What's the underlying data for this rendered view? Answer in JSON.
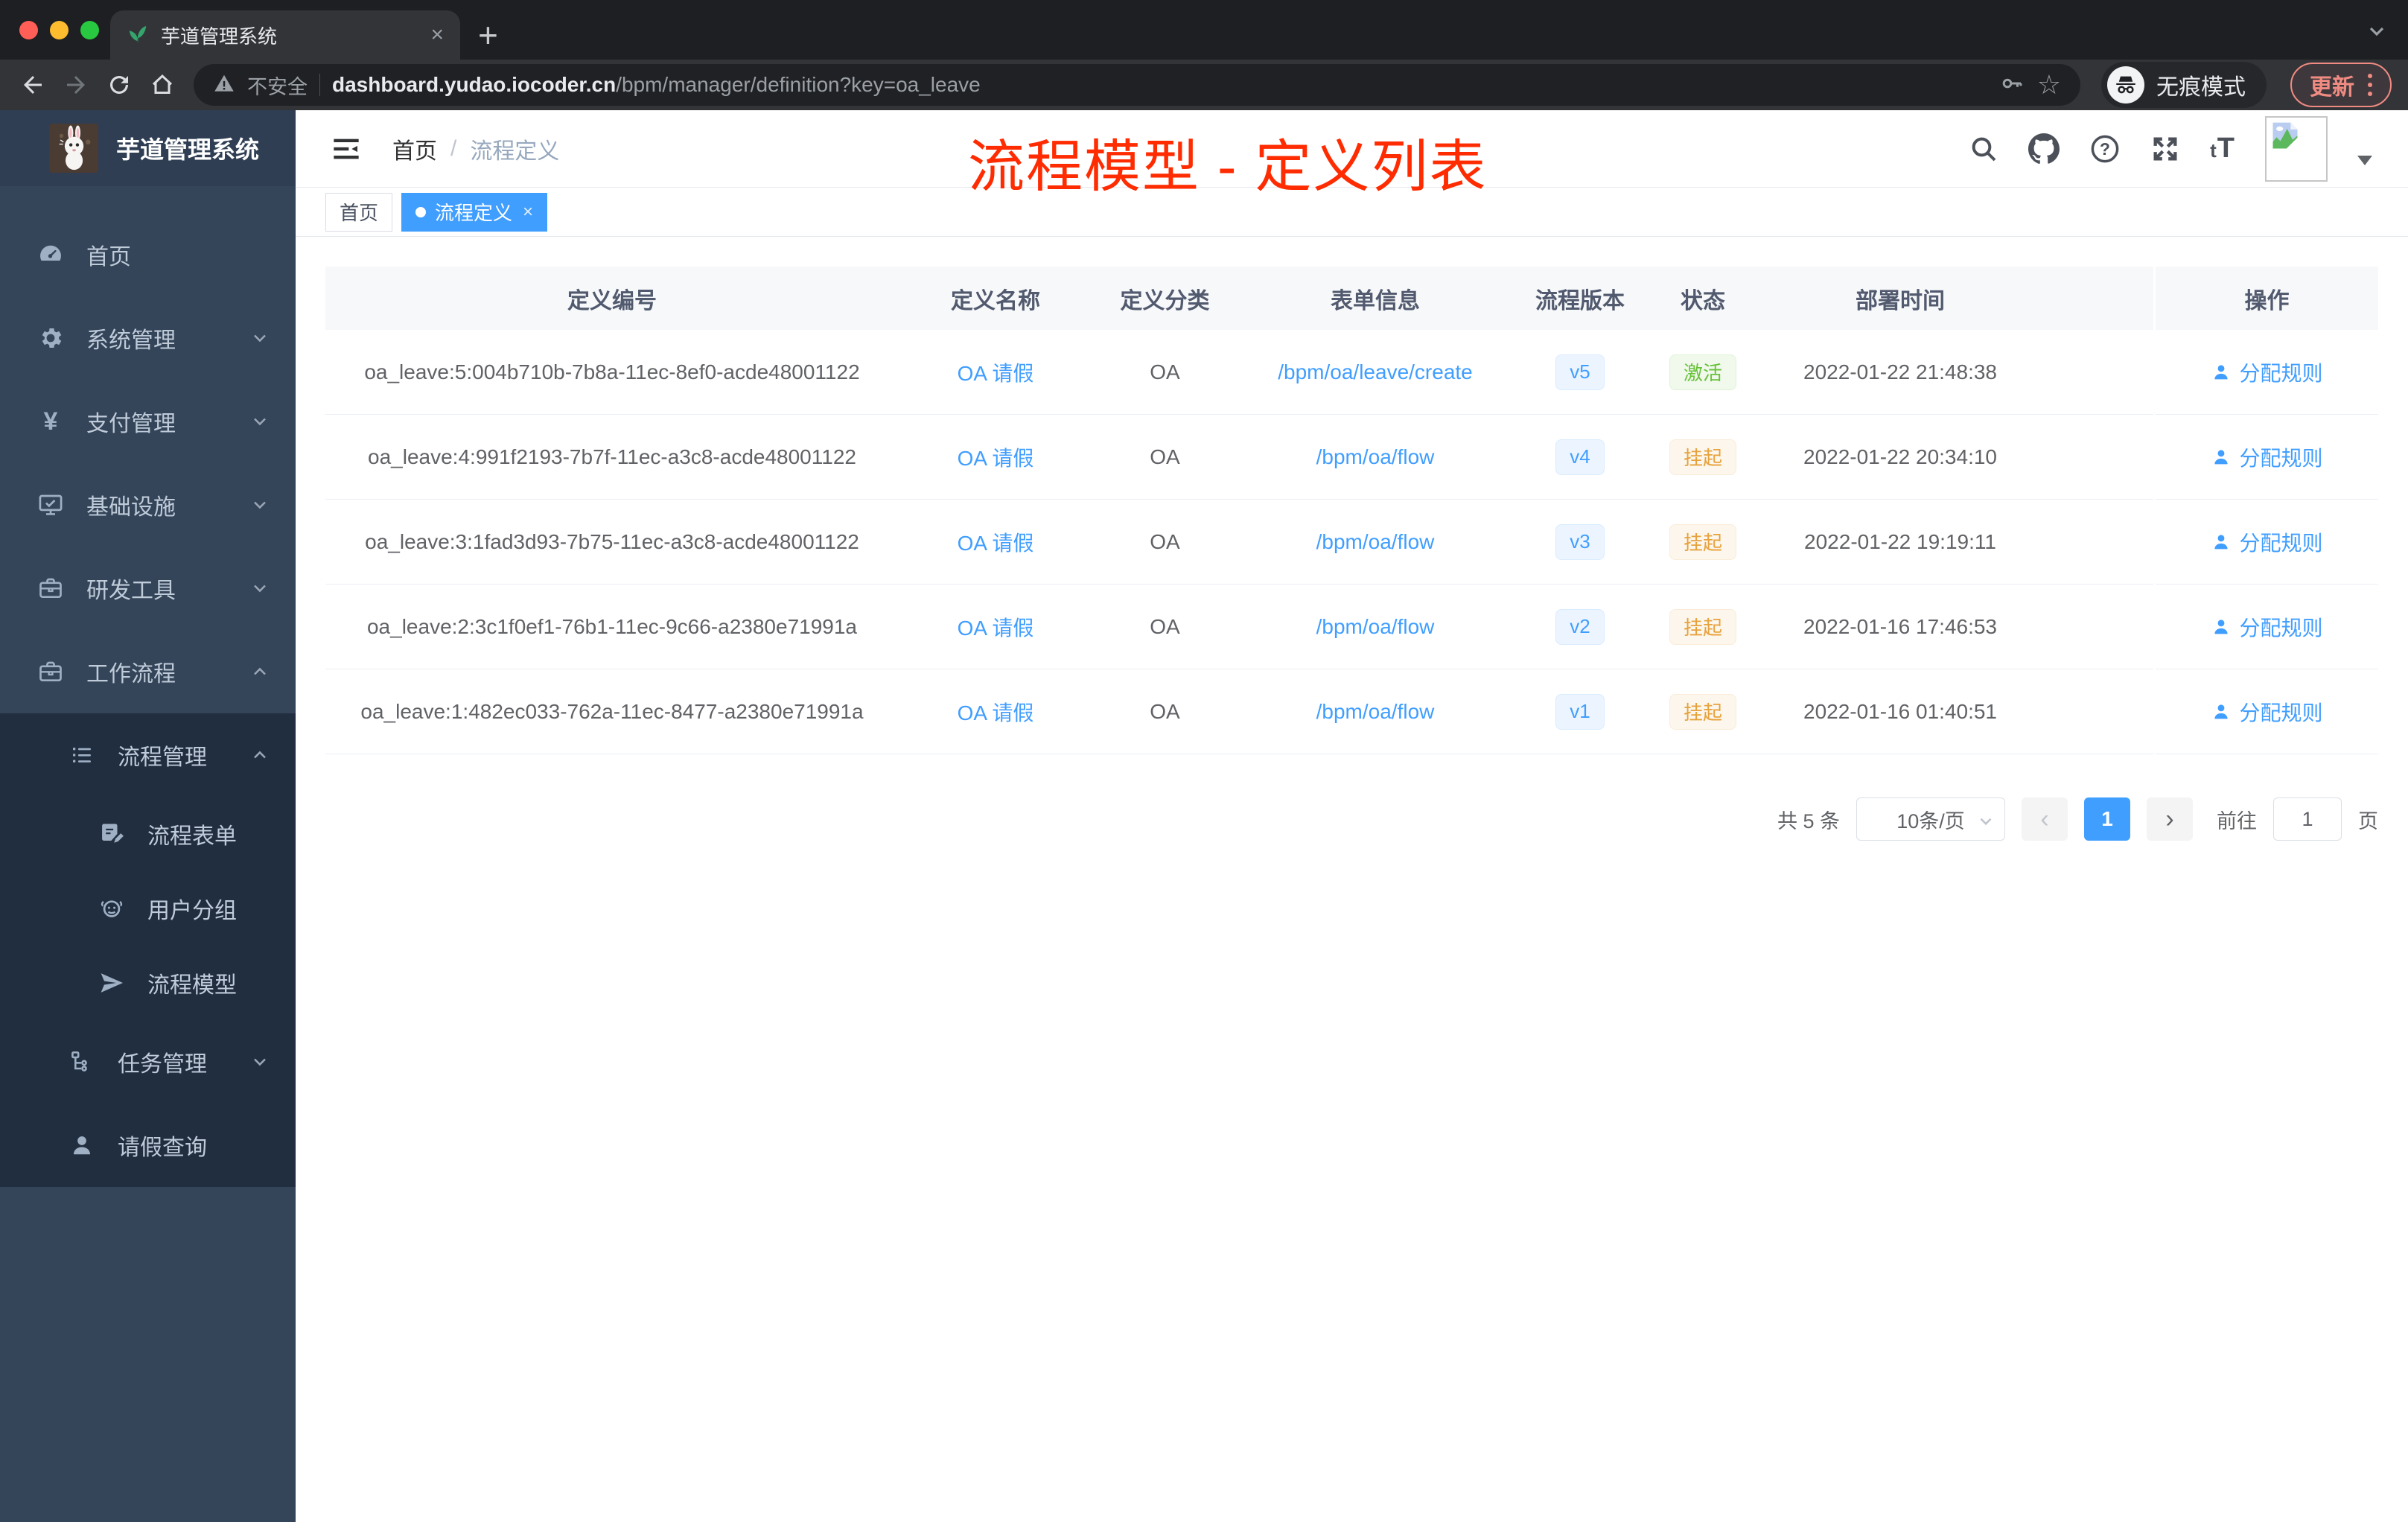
{
  "browser": {
    "tab_title": "芋道管理系统",
    "new_tab": "+",
    "security_label": "不安全",
    "url_host": "dashboard.yudao.iocoder.cn",
    "url_path": "/bpm/manager/definition?key=oa_leave",
    "incognito_label": "无痕模式",
    "update_label": "更新"
  },
  "sidebar": {
    "logo_title": "芋道管理系统",
    "items": [
      {
        "label": "首页",
        "icon": "dashboard",
        "level": 0,
        "chevron": "",
        "sub": false
      },
      {
        "label": "系统管理",
        "icon": "gear",
        "level": 0,
        "chevron": "down",
        "sub": false
      },
      {
        "label": "支付管理",
        "icon": "yen",
        "level": 0,
        "chevron": "down",
        "sub": false
      },
      {
        "label": "基础设施",
        "icon": "monitor",
        "level": 0,
        "chevron": "down",
        "sub": false
      },
      {
        "label": "研发工具",
        "icon": "toolbox",
        "level": 0,
        "chevron": "down",
        "sub": false
      },
      {
        "label": "工作流程",
        "icon": "briefcase",
        "level": 0,
        "chevron": "up",
        "sub": false
      },
      {
        "label": "流程管理",
        "icon": "list",
        "level": 1,
        "chevron": "up",
        "sub": true
      },
      {
        "label": "流程表单",
        "icon": "form",
        "level": 2,
        "chevron": "",
        "sub": true
      },
      {
        "label": "用户分组",
        "icon": "users",
        "level": 2,
        "chevron": "",
        "sub": true
      },
      {
        "label": "流程模型",
        "icon": "send",
        "level": 2,
        "chevron": "",
        "sub": true
      },
      {
        "label": "任务管理",
        "icon": "tree",
        "level": 1,
        "chevron": "down",
        "sub": true
      },
      {
        "label": "请假查询",
        "icon": "user",
        "level": 1,
        "chevron": "",
        "sub": true
      }
    ]
  },
  "navbar": {
    "breadcrumb_home": "首页",
    "breadcrumb_sep": "/",
    "breadcrumb_current": "流程定义",
    "annotation": "流程模型 - 定义列表"
  },
  "tags": [
    {
      "label": "首页",
      "active": false
    },
    {
      "label": "流程定义",
      "active": true,
      "close": "×"
    }
  ],
  "table": {
    "columns": [
      "定义编号",
      "定义名称",
      "定义分类",
      "表单信息",
      "流程版本",
      "状态",
      "部署时间",
      "操作"
    ],
    "action_label": "分配规则",
    "rows": [
      {
        "id": "oa_leave:5:004b710b-7b8a-11ec-8ef0-acde48001122",
        "name": "OA 请假",
        "category": "OA",
        "form": "/bpm/oa/leave/create",
        "version": "v5",
        "status": "active",
        "status_label": "激活",
        "deploy_time": "2022-01-22 21:48:38"
      },
      {
        "id": "oa_leave:4:991f2193-7b7f-11ec-a3c8-acde48001122",
        "name": "OA 请假",
        "category": "OA",
        "form": "/bpm/oa/flow",
        "version": "v4",
        "status": "suspended",
        "status_label": "挂起",
        "deploy_time": "2022-01-22 20:34:10"
      },
      {
        "id": "oa_leave:3:1fad3d93-7b75-11ec-a3c8-acde48001122",
        "name": "OA 请假",
        "category": "OA",
        "form": "/bpm/oa/flow",
        "version": "v3",
        "status": "suspended",
        "status_label": "挂起",
        "deploy_time": "2022-01-22 19:19:11"
      },
      {
        "id": "oa_leave:2:3c1f0ef1-76b1-11ec-9c66-a2380e71991a",
        "name": "OA 请假",
        "category": "OA",
        "form": "/bpm/oa/flow",
        "version": "v2",
        "status": "suspended",
        "status_label": "挂起",
        "deploy_time": "2022-01-16 17:46:53"
      },
      {
        "id": "oa_leave:1:482ec033-762a-11ec-8477-a2380e71991a",
        "name": "OA 请假",
        "category": "OA",
        "form": "/bpm/oa/flow",
        "version": "v1",
        "status": "suspended",
        "status_label": "挂起",
        "deploy_time": "2022-01-16 01:40:51"
      }
    ]
  },
  "pagination": {
    "total": "共 5 条",
    "page_size": "10条/页",
    "prev": "‹",
    "current": "1",
    "next": "›",
    "goto_prefix": "前往",
    "goto_value": "1",
    "goto_suffix": "页"
  },
  "colors": {
    "accent": "#409eff",
    "annotation": "#ff2b01",
    "update_accent": "#f08b82",
    "status_active": "#67c23a",
    "status_suspended": "#e6a23c",
    "sidebar_bg": "#344459",
    "submenu_bg": "#212e40",
    "traffic_red": "#ff5f57",
    "traffic_yellow": "#febc2e",
    "traffic_green": "#28c840"
  }
}
